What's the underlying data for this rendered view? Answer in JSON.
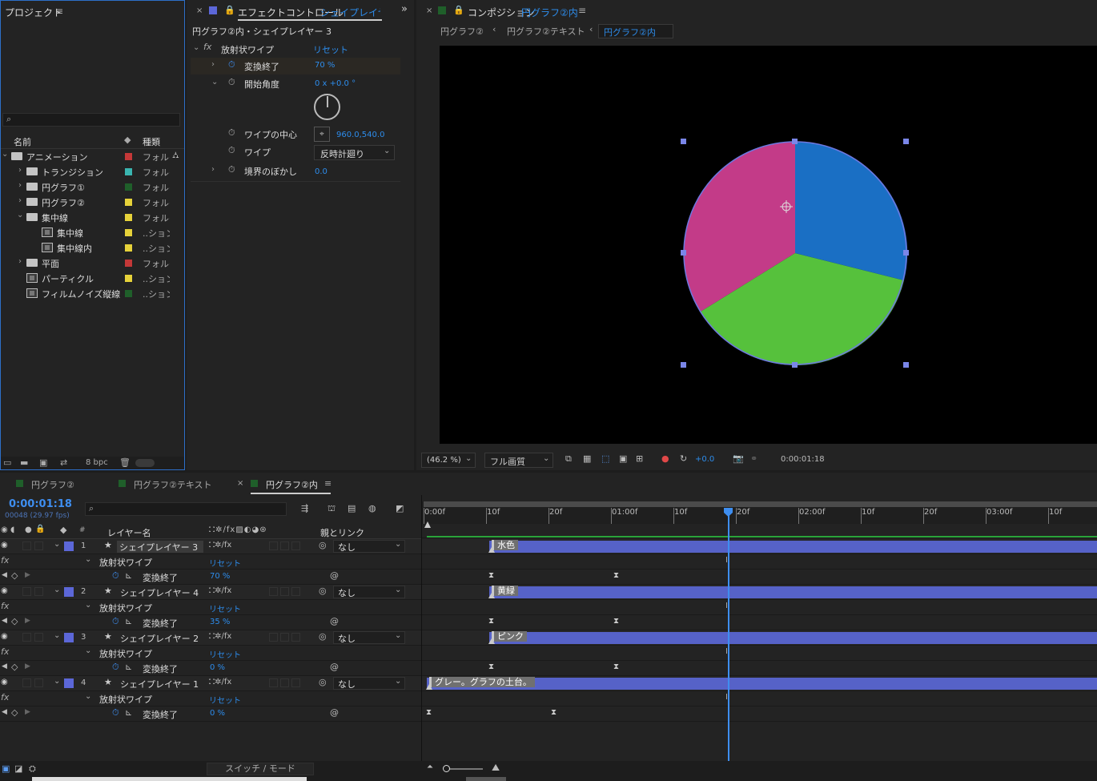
{
  "project": {
    "title": "プロジェクト",
    "search_placeholder": "",
    "col_name": "名前",
    "col_type": "種類",
    "items": [
      {
        "name": "アニメーション",
        "type": "フォルダ",
        "color": "#c43838"
      },
      {
        "name": "トランジション",
        "type": "フォルダ",
        "color": "#3ab5b0"
      },
      {
        "name": "円グラフ①",
        "type": "フォルダ",
        "color": "#1f5f2a"
      },
      {
        "name": "円グラフ②",
        "type": "フォルダ",
        "color": "#e6d23a"
      },
      {
        "name": "集中線",
        "type": "フォルダ",
        "color": "#e6d23a"
      },
      {
        "name": "集中線",
        "type": "..ション",
        "color": "#e6d23a"
      },
      {
        "name": "集中線内",
        "type": "..ション",
        "color": "#e6d23a"
      },
      {
        "name": "平面",
        "type": "フォルダ",
        "color": "#c43838"
      },
      {
        "name": "パーティクル",
        "type": "..ション",
        "color": "#e6d23a"
      },
      {
        "name": "フィルムノイズ縦線",
        "type": "..ション",
        "color": "#1f5f2a"
      }
    ],
    "bpc": "8 bpc"
  },
  "effects": {
    "tab_label": "エフェクトコントロール",
    "tab_layer": "シェイプレイヤー",
    "subtitle": "円グラフ②内・シェイプレイヤー 3",
    "effect_name": "放射状ワイプ",
    "reset": "リセット",
    "params": [
      {
        "label": "変換終了",
        "value": "70 %"
      },
      {
        "label": "開始角度",
        "value": "0 x +0.0 °"
      },
      {
        "label": "ワイプの中心",
        "value": "960.0,540.0"
      },
      {
        "label": "ワイプ",
        "value": "反時計廻り"
      },
      {
        "label": "境界のぼかし",
        "value": "0.0"
      }
    ]
  },
  "composition": {
    "tab_label": "コンポジション",
    "tab_comp": "円グラフ②内",
    "breadcrumbs": [
      "円グラフ②",
      "円グラフ②テキスト",
      "円グラフ②内"
    ],
    "zoom": "(46.2 %)",
    "quality": "フル画質",
    "exposure": "+0.0",
    "timecode": "0:00:01:18",
    "pie_colors": {
      "pink": "#c33b88",
      "blue": "#1a6fc4",
      "green": "#56c13c"
    }
  },
  "timeline": {
    "tabs": [
      "円グラフ②",
      "円グラフ②テキスト",
      "円グラフ②内"
    ],
    "timecode": "0:00:01:18",
    "frames": "00048 (29.97 fps)",
    "col_layer": "レイヤー名",
    "col_parent": "親とリンク",
    "switch_mode": "スイッチ / モード",
    "ruler": [
      "0:00f",
      "10f",
      "20f",
      "01:00f",
      "10f",
      "20f",
      "02:00f",
      "10f",
      "20f",
      "03:00f",
      "10f"
    ],
    "layers": [
      {
        "num": "1",
        "name": "シェイプレイヤー 3",
        "parent": "なし",
        "effect": "放射状ワイプ",
        "reset": "リセット",
        "prop": "変換終了",
        "value": "70 %",
        "bar_label": "水色"
      },
      {
        "num": "2",
        "name": "シェイプレイヤー 4",
        "parent": "なし",
        "effect": "放射状ワイプ",
        "reset": "リセット",
        "prop": "変換終了",
        "value": "35 %",
        "bar_label": "黄緑"
      },
      {
        "num": "3",
        "name": "シェイプレイヤー 2",
        "parent": "なし",
        "effect": "放射状ワイプ",
        "reset": "リセット",
        "prop": "変換終了",
        "value": "0 %",
        "bar_label": "ピンク"
      },
      {
        "num": "4",
        "name": "シェイプレイヤー 1",
        "parent": "なし",
        "effect": "放射状ワイプ",
        "reset": "リセット",
        "prop": "変換終了",
        "value": "0 %",
        "bar_label": "グレー。グラフの土台。"
      }
    ]
  }
}
